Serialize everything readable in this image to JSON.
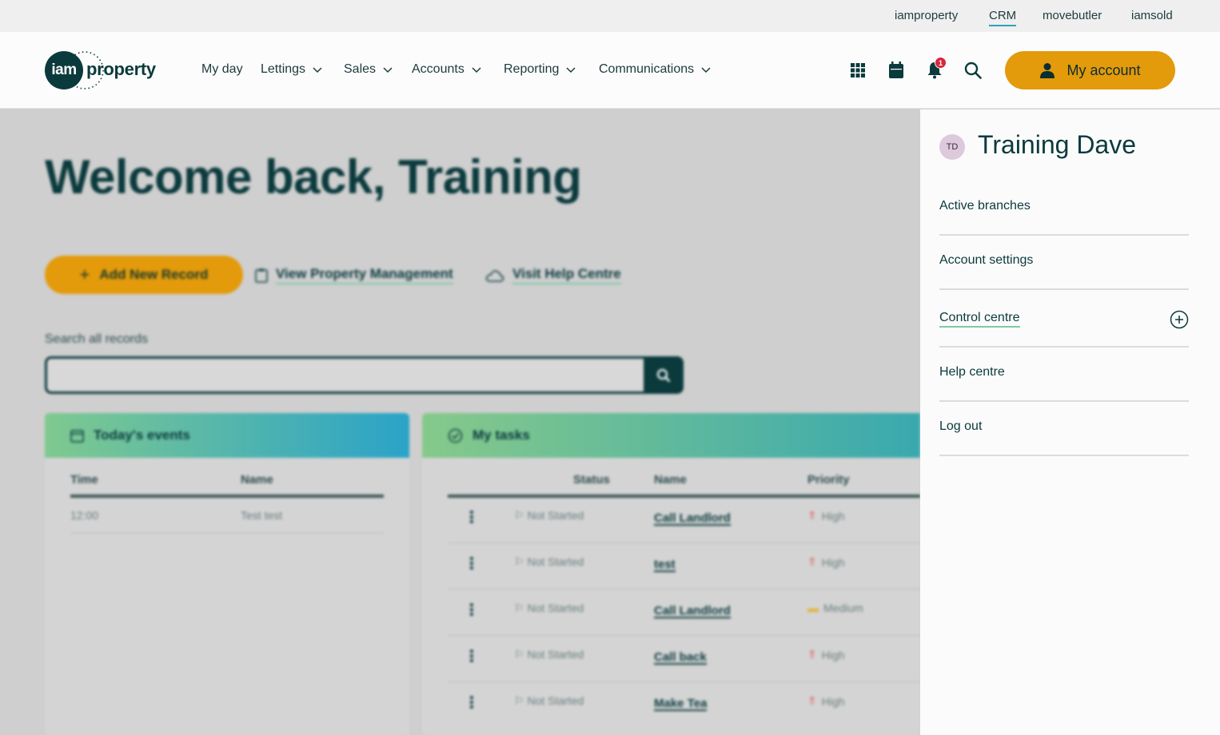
{
  "utility_links": [
    {
      "label": "iamproperty",
      "active": false
    },
    {
      "label": "CRM",
      "active": true
    },
    {
      "label": "movebutler",
      "active": false
    },
    {
      "label": "iamsold",
      "active": false
    }
  ],
  "logo": {
    "circle_text": "iam",
    "word": "property"
  },
  "nav": [
    {
      "label": "My day",
      "has_menu": false
    },
    {
      "label": "Lettings",
      "has_menu": true
    },
    {
      "label": "Sales",
      "has_menu": true
    },
    {
      "label": "Accounts",
      "has_menu": true
    },
    {
      "label": "Reporting",
      "has_menu": true
    },
    {
      "label": "Communications",
      "has_menu": true
    }
  ],
  "header_icons": [
    "apps-grid-icon",
    "calendar-icon",
    "bell-icon",
    "search-icon"
  ],
  "notifications": {
    "count": "1"
  },
  "account_button": {
    "label": "My account",
    "icon": "user-icon"
  },
  "main": {
    "welcome": "Welcome back, Training",
    "actions": {
      "add_new": "Add New Record",
      "view_pm": "View Property Management",
      "help": "Visit Help Centre"
    },
    "search": {
      "label": "Search all records",
      "placeholder": ""
    },
    "events": {
      "title": "Today's events",
      "columns": [
        "Time",
        "Name"
      ],
      "rows": [
        {
          "time": "12:00",
          "name": "Test test"
        }
      ]
    },
    "tasks": {
      "title": "My tasks",
      "columns": [
        "Status",
        "Name",
        "Priority"
      ],
      "rows": [
        {
          "status": "Not Started",
          "name": "Call Landlord",
          "priority": "High"
        },
        {
          "status": "Not Started",
          "name": "test",
          "priority": "High"
        },
        {
          "status": "Not Started",
          "name": "Call Landlord",
          "priority": "Medium"
        },
        {
          "status": "Not Started",
          "name": "Call back",
          "priority": "High"
        },
        {
          "status": "Not Started",
          "name": "Make Tea",
          "priority": "High"
        }
      ]
    }
  },
  "account_panel": {
    "initials": "TD",
    "name": "Training Dave",
    "items": [
      {
        "label": "Active branches"
      },
      {
        "label": "Account settings"
      },
      {
        "label": "Control centre",
        "expandable": true
      },
      {
        "label": "Help centre"
      },
      {
        "label": "Log out"
      }
    ]
  },
  "colors": {
    "brand_dark": "#0b3a3d",
    "accent_orange": "#e39a0b",
    "crm_underline": "#2aa3b8",
    "link_underline": "#7fc9a6",
    "badge_red": "#d7263d"
  }
}
